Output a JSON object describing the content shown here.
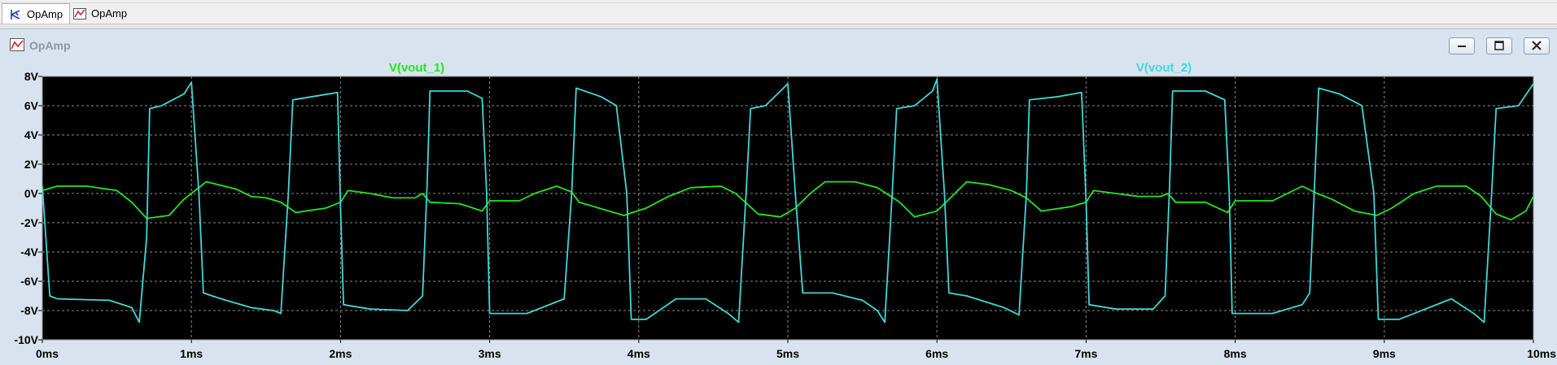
{
  "tabs": [
    {
      "label": "OpAmp",
      "icon": "schematic-icon",
      "active": true
    },
    {
      "label": "OpAmp",
      "icon": "waveform-icon",
      "active": false
    }
  ],
  "window": {
    "title": "OpAmp",
    "icon": "waveform-icon",
    "buttons": [
      "minimize-icon",
      "restore-icon",
      "close-icon"
    ]
  },
  "colors": {
    "plot_background": "#000000",
    "grid": "#8a8a8a",
    "vout_1": "#22e622",
    "vout_2": "#3fd8d8",
    "axis_text": "#ffffff"
  },
  "chart_data": {
    "type": "line",
    "xlim": [
      0,
      10
    ],
    "ylim": [
      -10,
      8
    ],
    "x_ticks": [
      "0ms",
      "1ms",
      "2ms",
      "3ms",
      "4ms",
      "5ms",
      "6ms",
      "7ms",
      "8ms",
      "9ms",
      "10ms"
    ],
    "y_ticks": [
      "8V",
      "6V",
      "4V",
      "2V",
      "0V",
      "-2V",
      "-4V",
      "-6V",
      "-8V",
      "-10V"
    ],
    "grid": true,
    "legend": "top",
    "series": [
      {
        "name": "V(vout_1)",
        "points": [
          [
            0,
            0.2
          ],
          [
            0.1,
            0.5
          ],
          [
            0.3,
            0.5
          ],
          [
            0.5,
            0.2
          ],
          [
            0.6,
            -0.6
          ],
          [
            0.7,
            -1.7
          ],
          [
            0.85,
            -1.5
          ],
          [
            0.95,
            -0.4
          ],
          [
            1.1,
            0.8
          ],
          [
            1.3,
            0.3
          ],
          [
            1.4,
            -0.2
          ],
          [
            1.5,
            -0.3
          ],
          [
            1.6,
            -0.6
          ],
          [
            1.7,
            -1.3
          ],
          [
            1.9,
            -1.0
          ],
          [
            2.0,
            -0.6
          ],
          [
            2.05,
            0.2
          ],
          [
            2.2,
            0.0
          ],
          [
            2.35,
            -0.3
          ],
          [
            2.5,
            -0.3
          ],
          [
            2.55,
            0.0
          ],
          [
            2.6,
            -0.6
          ],
          [
            2.8,
            -0.7
          ],
          [
            2.95,
            -1.2
          ],
          [
            3.0,
            -0.5
          ],
          [
            3.2,
            -0.5
          ],
          [
            3.3,
            0.0
          ],
          [
            3.45,
            0.5
          ],
          [
            3.55,
            0.1
          ],
          [
            3.6,
            -0.6
          ],
          [
            3.8,
            -1.2
          ],
          [
            3.9,
            -1.5
          ],
          [
            4.05,
            -1.0
          ],
          [
            4.2,
            -0.2
          ],
          [
            4.35,
            0.4
          ],
          [
            4.55,
            0.5
          ],
          [
            4.65,
            0.0
          ],
          [
            4.8,
            -1.4
          ],
          [
            4.95,
            -1.6
          ],
          [
            5.05,
            -1.0
          ],
          [
            5.15,
            0.0
          ],
          [
            5.25,
            0.8
          ],
          [
            5.45,
            0.8
          ],
          [
            5.6,
            0.4
          ],
          [
            5.75,
            -0.6
          ],
          [
            5.85,
            -1.6
          ],
          [
            6.0,
            -1.2
          ],
          [
            6.1,
            -0.2
          ],
          [
            6.2,
            0.8
          ],
          [
            6.35,
            0.6
          ],
          [
            6.5,
            0.2
          ],
          [
            6.6,
            -0.3
          ],
          [
            6.7,
            -1.2
          ],
          [
            6.9,
            -0.9
          ],
          [
            7.0,
            -0.6
          ],
          [
            7.05,
            0.2
          ],
          [
            7.2,
            0.0
          ],
          [
            7.35,
            -0.2
          ],
          [
            7.5,
            -0.2
          ],
          [
            7.55,
            0.0
          ],
          [
            7.6,
            -0.6
          ],
          [
            7.8,
            -0.6
          ],
          [
            7.95,
            -1.3
          ],
          [
            8.0,
            -0.5
          ],
          [
            8.25,
            -0.5
          ],
          [
            8.35,
            0.0
          ],
          [
            8.45,
            0.5
          ],
          [
            8.55,
            0.0
          ],
          [
            8.65,
            -0.4
          ],
          [
            8.8,
            -1.2
          ],
          [
            8.95,
            -1.5
          ],
          [
            9.05,
            -1.0
          ],
          [
            9.2,
            0.0
          ],
          [
            9.35,
            0.5
          ],
          [
            9.55,
            0.5
          ],
          [
            9.65,
            -0.2
          ],
          [
            9.75,
            -1.4
          ],
          [
            9.85,
            -1.8
          ],
          [
            9.95,
            -1.2
          ],
          [
            10.0,
            -0.2
          ]
        ]
      },
      {
        "name": "V(vout_2)",
        "points": [
          [
            0,
            0.5
          ],
          [
            0.05,
            -7.0
          ],
          [
            0.1,
            -7.2
          ],
          [
            0.45,
            -7.3
          ],
          [
            0.6,
            -7.8
          ],
          [
            0.65,
            -8.8
          ],
          [
            0.7,
            -3.0
          ],
          [
            0.72,
            5.8
          ],
          [
            0.8,
            6.0
          ],
          [
            0.95,
            6.8
          ],
          [
            1.0,
            7.6
          ],
          [
            1.05,
            0.0
          ],
          [
            1.08,
            -6.8
          ],
          [
            1.2,
            -7.2
          ],
          [
            1.4,
            -7.8
          ],
          [
            1.55,
            -8.0
          ],
          [
            1.6,
            -8.2
          ],
          [
            1.65,
            0.0
          ],
          [
            1.68,
            6.4
          ],
          [
            1.8,
            6.6
          ],
          [
            1.98,
            6.9
          ],
          [
            2.0,
            -1.0
          ],
          [
            2.02,
            -7.6
          ],
          [
            2.2,
            -7.9
          ],
          [
            2.45,
            -8.0
          ],
          [
            2.55,
            -7.0
          ],
          [
            2.58,
            0.5
          ],
          [
            2.6,
            7.0
          ],
          [
            2.85,
            7.0
          ],
          [
            2.95,
            6.5
          ],
          [
            2.98,
            0.0
          ],
          [
            3.0,
            -8.2
          ],
          [
            3.25,
            -8.2
          ],
          [
            3.5,
            -7.2
          ],
          [
            3.55,
            0.0
          ],
          [
            3.58,
            7.2
          ],
          [
            3.75,
            6.6
          ],
          [
            3.85,
            6.0
          ],
          [
            3.92,
            0.0
          ],
          [
            3.95,
            -8.6
          ],
          [
            4.05,
            -8.6
          ],
          [
            4.25,
            -7.2
          ],
          [
            4.45,
            -7.2
          ],
          [
            4.6,
            -8.2
          ],
          [
            4.67,
            -8.8
          ],
          [
            4.72,
            0.0
          ],
          [
            4.75,
            5.8
          ],
          [
            4.85,
            6.0
          ],
          [
            5.0,
            7.5
          ],
          [
            5.05,
            0.0
          ],
          [
            5.1,
            -6.8
          ],
          [
            5.3,
            -6.8
          ],
          [
            5.5,
            -7.3
          ],
          [
            5.6,
            -8.0
          ],
          [
            5.65,
            -8.8
          ],
          [
            5.7,
            0.0
          ],
          [
            5.73,
            5.8
          ],
          [
            5.85,
            6.0
          ],
          [
            5.97,
            7.0
          ],
          [
            6.0,
            7.8
          ],
          [
            6.05,
            0.0
          ],
          [
            6.08,
            -6.8
          ],
          [
            6.2,
            -7.0
          ],
          [
            6.45,
            -7.8
          ],
          [
            6.55,
            -8.3
          ],
          [
            6.6,
            0.0
          ],
          [
            6.62,
            6.4
          ],
          [
            6.8,
            6.6
          ],
          [
            6.97,
            6.9
          ],
          [
            7.0,
            -0.5
          ],
          [
            7.02,
            -7.6
          ],
          [
            7.2,
            -7.9
          ],
          [
            7.45,
            -7.9
          ],
          [
            7.53,
            -7.0
          ],
          [
            7.56,
            0.5
          ],
          [
            7.58,
            7.0
          ],
          [
            7.8,
            7.0
          ],
          [
            7.93,
            6.4
          ],
          [
            7.96,
            0.0
          ],
          [
            7.98,
            -8.2
          ],
          [
            8.25,
            -8.2
          ],
          [
            8.45,
            -7.6
          ],
          [
            8.5,
            -6.8
          ],
          [
            8.53,
            0.0
          ],
          [
            8.56,
            7.2
          ],
          [
            8.7,
            6.8
          ],
          [
            8.85,
            6.0
          ],
          [
            8.93,
            0.0
          ],
          [
            8.96,
            -8.6
          ],
          [
            9.1,
            -8.6
          ],
          [
            9.3,
            -7.8
          ],
          [
            9.45,
            -7.2
          ],
          [
            9.6,
            -8.2
          ],
          [
            9.67,
            -8.8
          ],
          [
            9.72,
            0.0
          ],
          [
            9.75,
            5.8
          ],
          [
            9.9,
            6.0
          ],
          [
            10.0,
            7.5
          ]
        ]
      }
    ]
  }
}
